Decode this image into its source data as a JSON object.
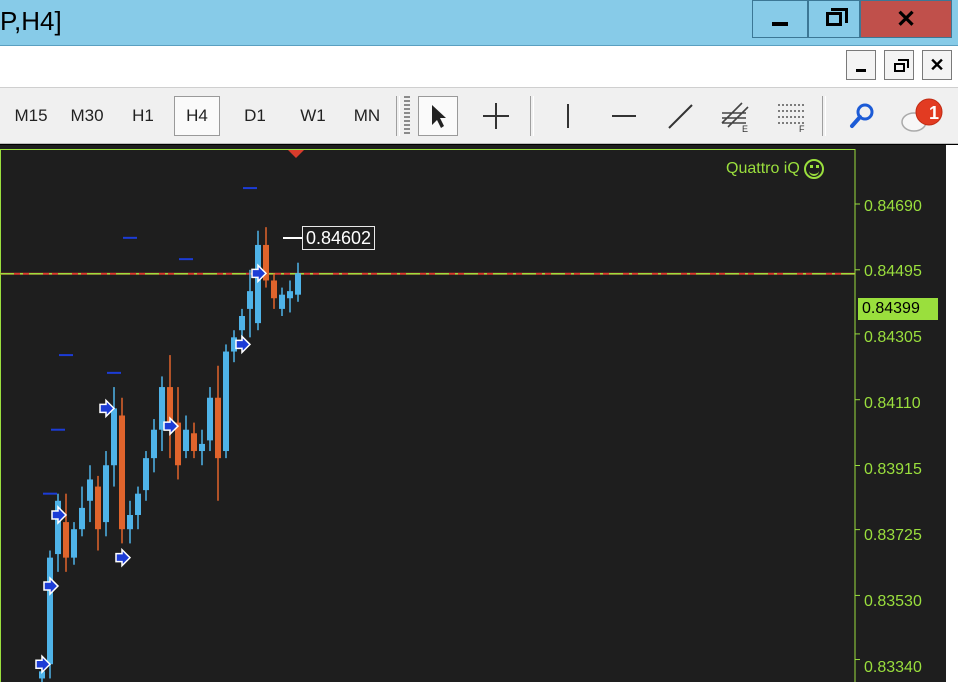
{
  "window": {
    "title": "P,H4]",
    "buttons": [
      "minimize",
      "maximize",
      "close"
    ]
  },
  "toolbar": {
    "timeframes": [
      {
        "label": "M15",
        "active": false
      },
      {
        "label": "M30",
        "active": false
      },
      {
        "label": "H1",
        "active": false
      },
      {
        "label": "H4",
        "active": true
      },
      {
        "label": "D1",
        "active": false
      },
      {
        "label": "W1",
        "active": false
      },
      {
        "label": "MN",
        "active": false
      }
    ],
    "tools": [
      "cursor-icon",
      "crosshair-icon",
      "vertical-line-icon",
      "horizontal-line-icon",
      "trendline-icon",
      "fibonacci-icon",
      "fibonacci-fan-icon",
      "search-icon",
      "notification-icon"
    ],
    "notification_count": "1"
  },
  "chart": {
    "indicator_label": "Quattro iQ",
    "marker_price": "0.84602",
    "current_price": "0.84399",
    "y_ticks": [
      "0.84690",
      "0.84495",
      "0.84305",
      "0.84110",
      "0.83915",
      "0.83725",
      "0.83530",
      "0.83340"
    ],
    "colors": {
      "background": "#1e1e1e",
      "bull": "#4fb3e8",
      "bear": "#e0642c",
      "axis": "#9adf3d",
      "price_line": "#d83c2c",
      "arrow_marker": "#1c3cd6"
    }
  },
  "chart_data": {
    "type": "candlestick",
    "y_range": [
      0.8325,
      0.8475
    ],
    "candles": [
      {
        "o": 0.8326,
        "h": 0.833,
        "l": 0.8318,
        "c": 0.8328
      },
      {
        "o": 0.833,
        "h": 0.8362,
        "l": 0.8326,
        "c": 0.836
      },
      {
        "o": 0.8361,
        "h": 0.8378,
        "l": 0.8356,
        "c": 0.8376
      },
      {
        "o": 0.837,
        "h": 0.8378,
        "l": 0.8356,
        "c": 0.836
      },
      {
        "o": 0.836,
        "h": 0.837,
        "l": 0.8358,
        "c": 0.8368
      },
      {
        "o": 0.8368,
        "h": 0.838,
        "l": 0.8366,
        "c": 0.8374
      },
      {
        "o": 0.8376,
        "h": 0.8386,
        "l": 0.837,
        "c": 0.8382
      },
      {
        "o": 0.838,
        "h": 0.8383,
        "l": 0.8362,
        "c": 0.8368
      },
      {
        "o": 0.837,
        "h": 0.839,
        "l": 0.8366,
        "c": 0.8386
      },
      {
        "o": 0.8386,
        "h": 0.8408,
        "l": 0.838,
        "c": 0.8402
      },
      {
        "o": 0.84,
        "h": 0.8405,
        "l": 0.8364,
        "c": 0.8368
      },
      {
        "o": 0.8368,
        "h": 0.8376,
        "l": 0.8364,
        "c": 0.8372
      },
      {
        "o": 0.8372,
        "h": 0.838,
        "l": 0.8368,
        "c": 0.8378
      },
      {
        "o": 0.8379,
        "h": 0.839,
        "l": 0.8376,
        "c": 0.8388
      },
      {
        "o": 0.8388,
        "h": 0.8399,
        "l": 0.8384,
        "c": 0.8396
      },
      {
        "o": 0.8396,
        "h": 0.8411,
        "l": 0.839,
        "c": 0.8408
      },
      {
        "o": 0.8408,
        "h": 0.8417,
        "l": 0.8388,
        "c": 0.8396
      },
      {
        "o": 0.8398,
        "h": 0.8408,
        "l": 0.8382,
        "c": 0.8386
      },
      {
        "o": 0.839,
        "h": 0.84,
        "l": 0.8388,
        "c": 0.8396
      },
      {
        "o": 0.8395,
        "h": 0.8398,
        "l": 0.8388,
        "c": 0.839
      },
      {
        "o": 0.839,
        "h": 0.8396,
        "l": 0.8386,
        "c": 0.8392
      },
      {
        "o": 0.8393,
        "h": 0.8408,
        "l": 0.839,
        "c": 0.8405
      },
      {
        "o": 0.8405,
        "h": 0.8414,
        "l": 0.8376,
        "c": 0.8388
      },
      {
        "o": 0.839,
        "h": 0.842,
        "l": 0.8388,
        "c": 0.8418
      },
      {
        "o": 0.8418,
        "h": 0.8424,
        "l": 0.8415,
        "c": 0.8422
      },
      {
        "o": 0.8424,
        "h": 0.843,
        "l": 0.842,
        "c": 0.8428
      },
      {
        "o": 0.843,
        "h": 0.8441,
        "l": 0.8422,
        "c": 0.8435
      },
      {
        "o": 0.8426,
        "h": 0.8452,
        "l": 0.8424,
        "c": 0.8448
      },
      {
        "o": 0.8448,
        "h": 0.8453,
        "l": 0.8436,
        "c": 0.8438
      },
      {
        "o": 0.8438,
        "h": 0.844,
        "l": 0.843,
        "c": 0.8433
      },
      {
        "o": 0.843,
        "h": 0.8436,
        "l": 0.8428,
        "c": 0.8434
      },
      {
        "o": 0.8433,
        "h": 0.8438,
        "l": 0.8429,
        "c": 0.8435
      },
      {
        "o": 0.8434,
        "h": 0.8443,
        "l": 0.8432,
        "c": 0.844
      }
    ],
    "arrows": [
      {
        "index": 0,
        "price": 0.833
      },
      {
        "index": 1,
        "price": 0.8352
      },
      {
        "index": 2,
        "price": 0.8372
      },
      {
        "index": 8,
        "price": 0.8402
      },
      {
        "index": 10,
        "price": 0.836
      },
      {
        "index": 16,
        "price": 0.8397
      },
      {
        "index": 25,
        "price": 0.842
      },
      {
        "index": 27,
        "price": 0.844
      }
    ],
    "dashes": [
      {
        "index": 1,
        "price": 0.8378
      },
      {
        "index": 2,
        "price": 0.8396
      },
      {
        "index": 3,
        "price": 0.8417
      },
      {
        "index": 9,
        "price": 0.8412
      },
      {
        "index": 11,
        "price": 0.845
      },
      {
        "index": 18,
        "price": 0.8444
      },
      {
        "index": 26,
        "price": 0.8464
      },
      {
        "index": 28,
        "price": 0.8484
      }
    ],
    "horizontal_lines": [
      {
        "price": 0.84399,
        "style": "solid",
        "color": "#d83c2c"
      },
      {
        "price": 0.84399,
        "style": "dash-dot",
        "color": "#9adf3d"
      },
      {
        "price": 0.8483,
        "style": "dash-dot",
        "color": "#c85a50"
      }
    ]
  }
}
